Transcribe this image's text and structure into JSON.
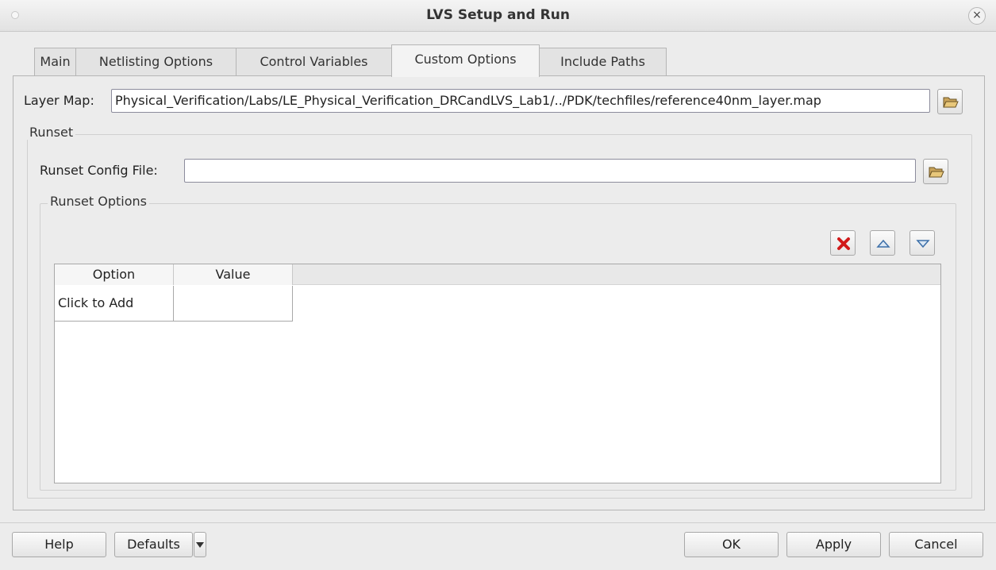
{
  "window": {
    "title": "LVS Setup and Run"
  },
  "tabs": [
    {
      "label": "Main",
      "active": false
    },
    {
      "label": "Netlisting Options",
      "active": false
    },
    {
      "label": "Control Variables",
      "active": false
    },
    {
      "label": "Custom Options",
      "active": true
    },
    {
      "label": "Include Paths",
      "active": false
    }
  ],
  "layer_map": {
    "label": "Layer Map:",
    "value": "Physical_Verification/Labs/LE_Physical_Verification_DRCandLVS_Lab1/../PDK/techfiles/reference40nm_layer.map"
  },
  "runset": {
    "group_title": "Runset",
    "config_file_label": "Runset Config File:",
    "config_file_value": "",
    "options_group_title": "Runset Options"
  },
  "options_table": {
    "columns": [
      "Option",
      "Value"
    ],
    "rows": [
      [
        "Click to Add",
        ""
      ]
    ]
  },
  "toolbar_icons": [
    "delete-icon",
    "move-up-icon",
    "move-down-icon"
  ],
  "buttons": {
    "help": "Help",
    "defaults": "Defaults",
    "ok": "OK",
    "apply": "Apply",
    "cancel": "Cancel"
  },
  "colors": {
    "delete_red": "#d11a1a",
    "arrow_blue": "#3b6ea8"
  }
}
